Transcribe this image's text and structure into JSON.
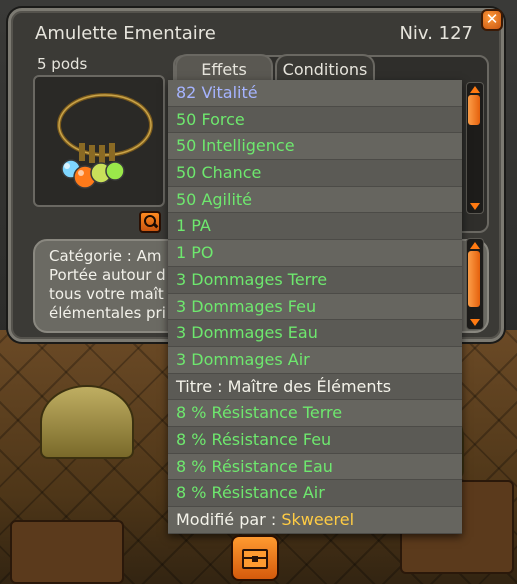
{
  "item": {
    "name": "Amulette Ementaire",
    "level": "Niv. 127",
    "weight": "5 pods"
  },
  "tabs": [
    {
      "label": "Effets"
    },
    {
      "label": "Conditions"
    }
  ],
  "description": {
    "lines": [
      "Catégorie : Am",
      "Portée autour d",
      "tous votre maît",
      "élémentales pri"
    ]
  },
  "effects": [
    {
      "text": "82 Vitalité"
    },
    {
      "text": "50 Force"
    },
    {
      "text": "50 Intelligence"
    },
    {
      "text": "50 Chance"
    },
    {
      "text": "50 Agilité"
    },
    {
      "text": "1 PA"
    },
    {
      "text": "1 PO"
    },
    {
      "text": "3 Dommages Terre"
    },
    {
      "text": "3 Dommages Feu"
    },
    {
      "text": "3 Dommages Eau"
    },
    {
      "text": "3 Dommages Air"
    },
    {
      "text": "Titre : Maître des Éléments"
    },
    {
      "text": "8 % Résistance Terre"
    },
    {
      "text": "8 % Résistance Feu"
    },
    {
      "text": "8 % Résistance Eau"
    },
    {
      "text": "8 % Résistance Air"
    }
  ],
  "modified_by": {
    "label": "Modifié par : ",
    "name": "Skweerel"
  },
  "colors": {
    "vitality": "#a6b4ff",
    "stat_green": "#6ee86e",
    "accent_orange": "#ff7a12",
    "player_name": "#ffcc44"
  },
  "icons": {
    "close": "close-icon",
    "zoom": "magnifier-icon",
    "inventory": "chest-icon"
  }
}
